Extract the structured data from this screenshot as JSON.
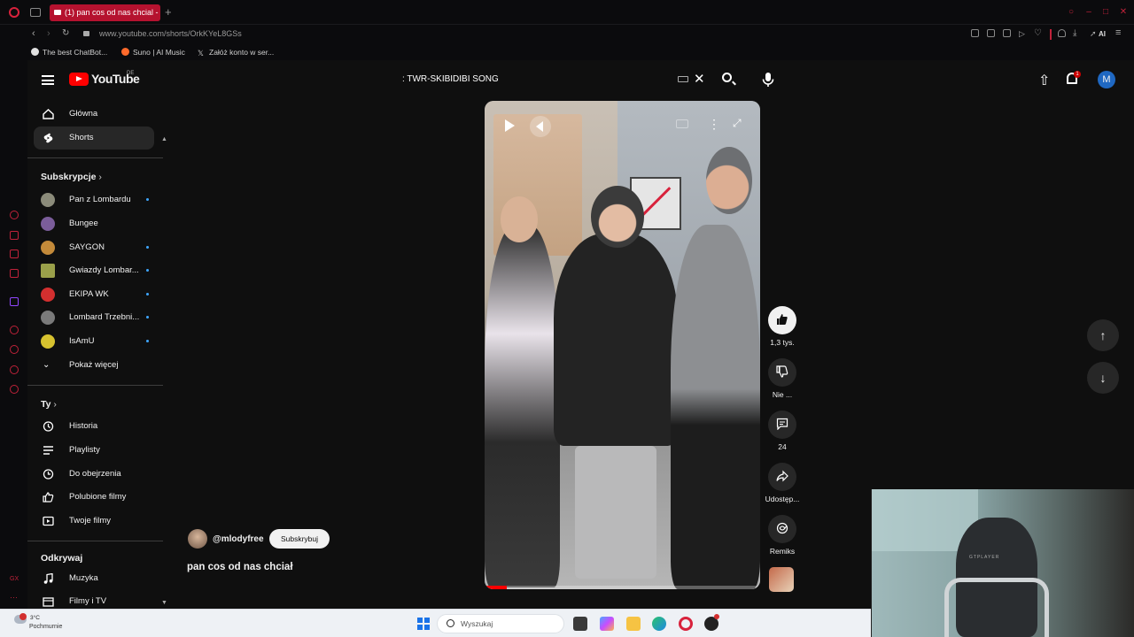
{
  "browser": {
    "tab_title": "(1) pan cos od nas chcial -",
    "new_tab_glyph": "+",
    "url": "www.youtube.com/shorts/OrkKYeL8GSs",
    "ai_label": "AI",
    "bookmarks": [
      {
        "label": "The best ChatBot...",
        "color": "#e0e0e0"
      },
      {
        "label": "Suno | AI Music",
        "color": "#ff6a2b"
      },
      {
        "label": "Załóż konto w ser...",
        "color": "#ffffff"
      }
    ],
    "icons": [
      "opera-icon",
      "tab-islands-icon",
      "back-icon",
      "forward-icon",
      "reload-icon",
      "lock-icon",
      "bookmark-icon",
      "snapshot-icon",
      "shield-icon",
      "player-icon",
      "heart-icon",
      "download-icon",
      "share-icon",
      "menu-icon"
    ]
  },
  "youtube": {
    "logo_text": "YouTube",
    "region": "DE",
    "search_value": ": TWR-SKIBIDIBI SONG",
    "notification_count": "1",
    "avatar_letter": "M",
    "sidebar": {
      "main": [
        {
          "label": "Główna",
          "icon": "home-icon"
        },
        {
          "label": "Shorts",
          "icon": "shorts-icon",
          "selected": true
        }
      ],
      "subscriptions_heading": "Subskrypcje",
      "subscriptions": [
        {
          "label": "Pan z Lombardu",
          "color": "#8b8b7a",
          "dot": true
        },
        {
          "label": "Bungee",
          "color": "#7b5d9a",
          "dot": false
        },
        {
          "label": "SAYGON",
          "color": "#c38a3a",
          "dot": true
        },
        {
          "label": "Gwiazdy Lombar...",
          "color": "#9aa04a",
          "dot": true
        },
        {
          "label": "EKIPA WK",
          "color": "#d32f2f",
          "dot": true
        },
        {
          "label": "Lombard Trzebni...",
          "color": "#7a7a7a",
          "dot": true
        },
        {
          "label": "IsAmU",
          "color": "#d7c22f",
          "dot": true
        }
      ],
      "show_more": "Pokaż więcej",
      "you_heading": "Ty",
      "you_items": [
        {
          "label": "Historia",
          "icon": "history-icon"
        },
        {
          "label": "Playlisty",
          "icon": "playlist-icon"
        },
        {
          "label": "Do obejrzenia",
          "icon": "watch-later-icon"
        },
        {
          "label": "Polubione filmy",
          "icon": "like-icon"
        },
        {
          "label": "Twoje filmy",
          "icon": "your-videos-icon"
        }
      ],
      "explore_heading": "Odkrywaj",
      "explore_items": [
        {
          "label": "Muzyka",
          "icon": "music-icon"
        },
        {
          "label": "Filmy i TV",
          "icon": "movies-icon"
        }
      ]
    },
    "short": {
      "channel_handle": "@mlodyfree",
      "subscribe_label": "Subskrybuj",
      "title": "pan cos od nas chciał",
      "progress": 0.08,
      "actions": [
        {
          "name": "like",
          "label": "1,3 tys."
        },
        {
          "name": "dislike",
          "label": "Nie ..."
        },
        {
          "name": "comments",
          "label": "24"
        },
        {
          "name": "share",
          "label": "Udostęp..."
        },
        {
          "name": "remix",
          "label": "Remiks"
        }
      ]
    }
  },
  "webcam": {
    "chair_text": "GTPLAYER"
  },
  "taskbar": {
    "temperature": "3°C",
    "condition": "Pochmurnie",
    "search_placeholder": "Wyszukaj",
    "apps": [
      "file-explorer-icon",
      "copilot-icon",
      "folder-icon",
      "edge-icon",
      "opera-icon",
      "obs-icon"
    ]
  }
}
